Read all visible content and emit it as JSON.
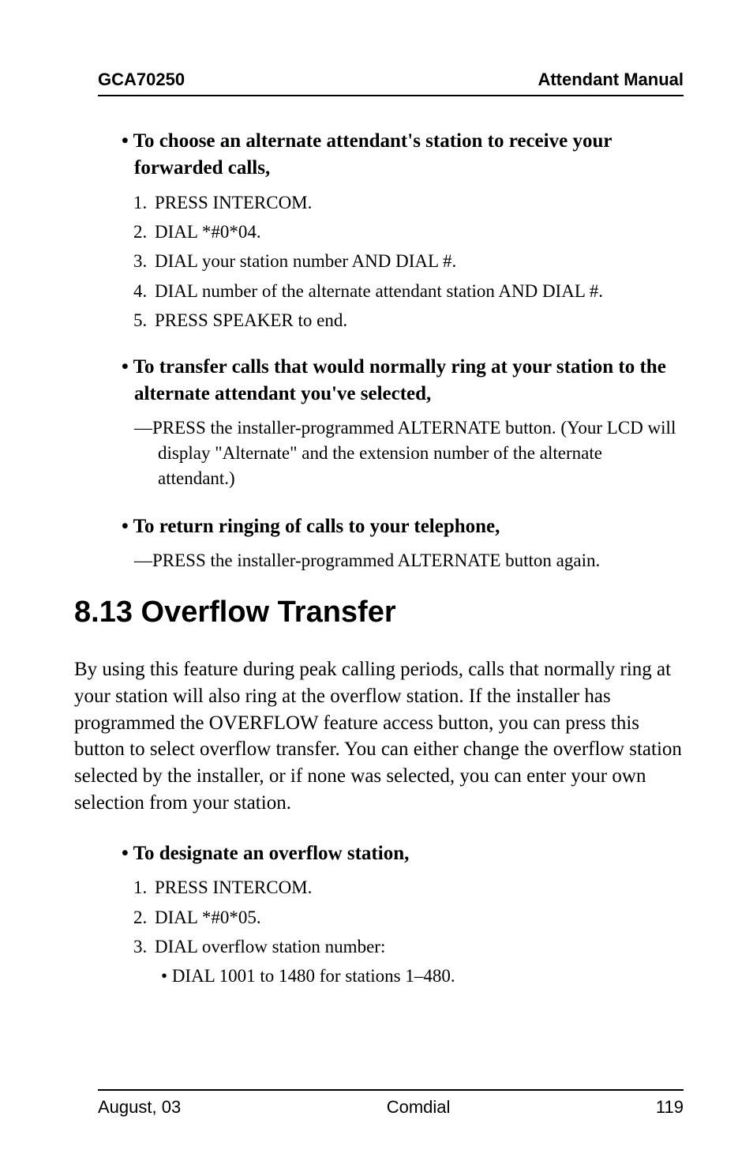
{
  "header": {
    "left": "GCA70250",
    "right": "Attendant Manual"
  },
  "sec1": {
    "head": "To choose an alternate attendant's station to receive your forwarded calls,",
    "steps": [
      "PRESS INTERCOM.",
      "DIAL  *#0*04.",
      "DIAL your station number AND DIAL  #.",
      "DIAL number of the alternate attendant station AND DIAL  #.",
      "PRESS SPEAKER to end."
    ]
  },
  "sec2": {
    "head": "To transfer calls that would normally ring at your station to the alternate attendant you've selected,",
    "dash": "PRESS the installer-programmed ALTERNATE button. (Your LCD will display \"Alternate\" and the extension number of the alternate attendant.)"
  },
  "sec3": {
    "head": "To return ringing of calls to your telephone,",
    "dash": "PRESS the installer-programmed ALTERNATE button again."
  },
  "overflow": {
    "title": "8.13  Overflow Transfer",
    "para": "By using this feature during peak calling periods, calls that normally ring at your station will also ring at the overflow station. If the installer has programmed the OVERFLOW  feature access button, you can press this button to select overflow transfer. You can either change the overflow station selected by the installer, or if none was selected, you can enter your own selection from your station.",
    "head": "To designate an overflow station,",
    "steps": [
      "PRESS INTERCOM.",
      "DIAL  *#0*05.",
      "DIAL overflow station number:"
    ],
    "sub": "DIAL  1001  to  1480  for stations 1–480."
  },
  "footer": {
    "left": "August, 03",
    "center": "Comdial",
    "right": "119"
  }
}
